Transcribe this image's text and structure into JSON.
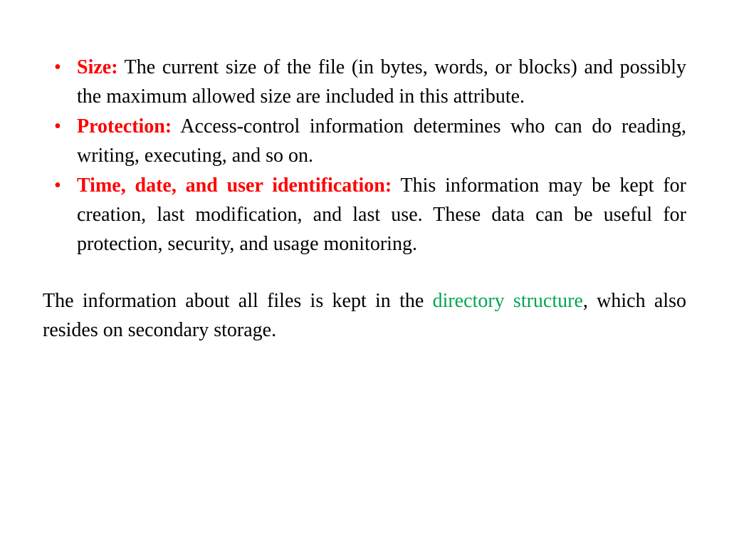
{
  "bullets": [
    {
      "label": "Size:",
      "text": " The current size of the file (in bytes, words, or blocks) and possibly the maximum allowed size are included in this attribute."
    },
    {
      "label": "Protection:",
      "text": " Access-control information determines who can do reading, writing, executing, and so on."
    },
    {
      "label": "Time, date, and user identification:",
      "text": " This information may be kept for creation, last modification, and last use. These data can be useful for protection, security, and usage monitoring."
    }
  ],
  "paragraph": {
    "prefix": "The information about all files is kept in the ",
    "highlight": "directory structure",
    "suffix": ", which also resides on secondary storage."
  }
}
